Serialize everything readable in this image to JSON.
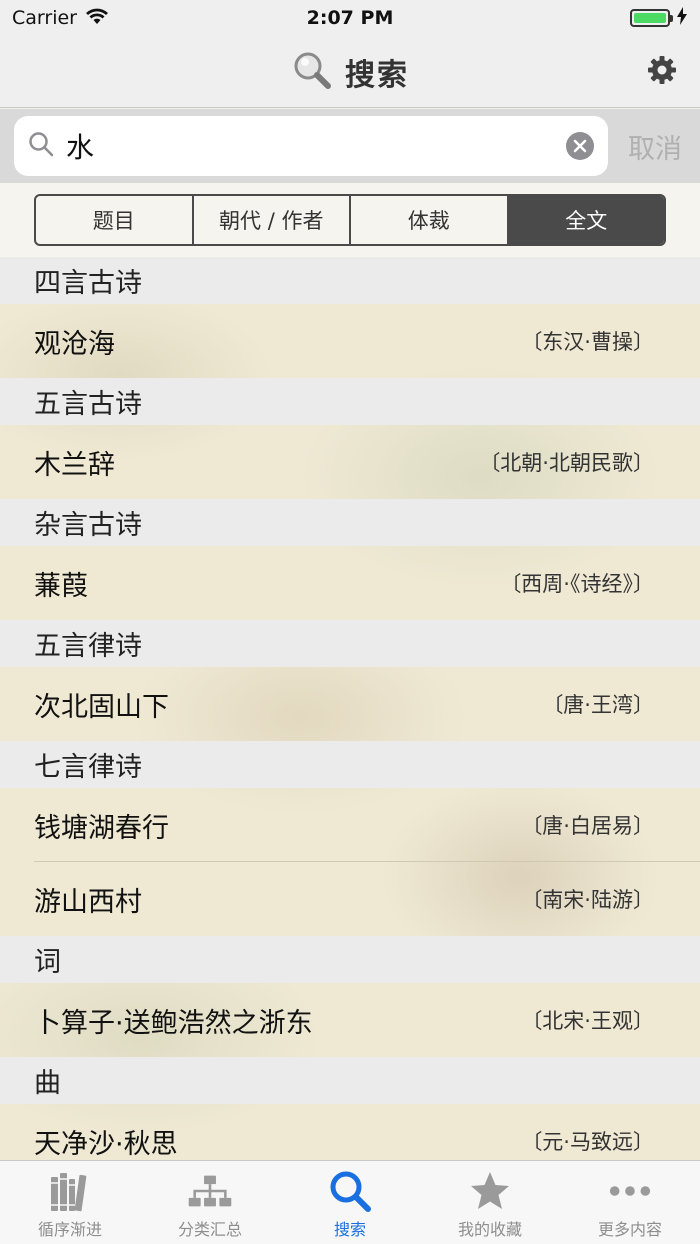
{
  "status": {
    "carrier": "Carrier",
    "time": "2:07 PM"
  },
  "nav": {
    "title": "搜索"
  },
  "search": {
    "value": "水",
    "cancel_label": "取消"
  },
  "segments": [
    {
      "label": "题目",
      "active": false
    },
    {
      "label": "朝代 / 作者",
      "active": false
    },
    {
      "label": "体裁",
      "active": false
    },
    {
      "label": "全文",
      "active": true
    }
  ],
  "sections": [
    {
      "header": "四言古诗",
      "rows": [
        {
          "title": "观沧海",
          "author": "〔东汉·曹操〕"
        }
      ]
    },
    {
      "header": "五言古诗",
      "rows": [
        {
          "title": "木兰辞",
          "author": "〔北朝·北朝民歌〕"
        }
      ]
    },
    {
      "header": "杂言古诗",
      "rows": [
        {
          "title": "蒹葭",
          "author": "〔西周·《诗经》〕"
        }
      ]
    },
    {
      "header": "五言律诗",
      "rows": [
        {
          "title": "次北固山下",
          "author": "〔唐·王湾〕"
        }
      ]
    },
    {
      "header": "七言律诗",
      "rows": [
        {
          "title": "钱塘湖春行",
          "author": "〔唐·白居易〕"
        },
        {
          "title": "游山西村",
          "author": "〔南宋·陆游〕"
        }
      ]
    },
    {
      "header": "词",
      "rows": [
        {
          "title": "卜算子·送鲍浩然之浙东",
          "author": "〔北宋·王观〕"
        }
      ]
    },
    {
      "header": "曲",
      "rows": [
        {
          "title": "天净沙·秋思",
          "author": "〔元·马致远〕"
        }
      ]
    }
  ],
  "tabs": [
    {
      "label": "循序渐进",
      "icon": "books-icon",
      "active": false
    },
    {
      "label": "分类汇总",
      "icon": "hierarchy-icon",
      "active": false
    },
    {
      "label": "搜索",
      "icon": "search-icon",
      "active": true
    },
    {
      "label": "我的收藏",
      "icon": "star-icon",
      "active": false
    },
    {
      "label": "更多内容",
      "icon": "more-icon",
      "active": false
    }
  ],
  "colors": {
    "accent": "#1a6fe0",
    "battery": "#4cd964"
  }
}
